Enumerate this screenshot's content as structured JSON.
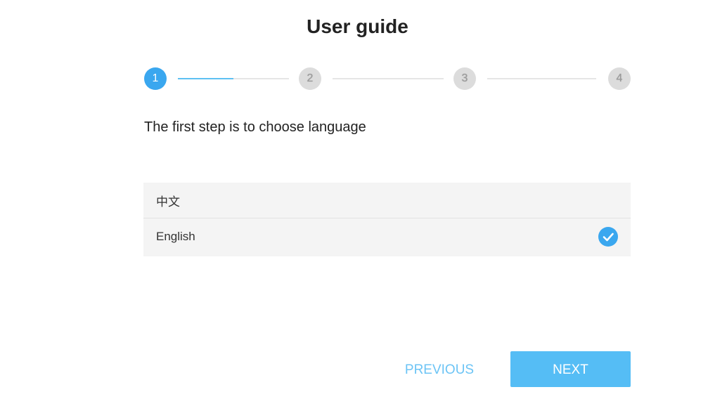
{
  "header": {
    "title": "User guide"
  },
  "stepper": {
    "steps": [
      {
        "label": "1",
        "state": "active"
      },
      {
        "label": "2",
        "state": "inactive"
      },
      {
        "label": "3",
        "state": "inactive"
      },
      {
        "label": "4",
        "state": "inactive"
      }
    ],
    "current_step": 1,
    "first_connector_progress": 0.5
  },
  "content": {
    "instruction": "The first step is to choose language",
    "languages": [
      {
        "label": "中文",
        "selected": false
      },
      {
        "label": "English",
        "selected": true
      }
    ]
  },
  "footer": {
    "previous_label": "PREVIOUS",
    "next_label": "NEXT"
  },
  "colors": {
    "accent": "#3aa7ef",
    "next_button": "#55bdf5",
    "previous_text": "#6cc4f5",
    "inactive_step": "#dcdcdc",
    "list_background": "#f4f4f4"
  },
  "icons": {
    "selected": "check-circle-icon"
  }
}
